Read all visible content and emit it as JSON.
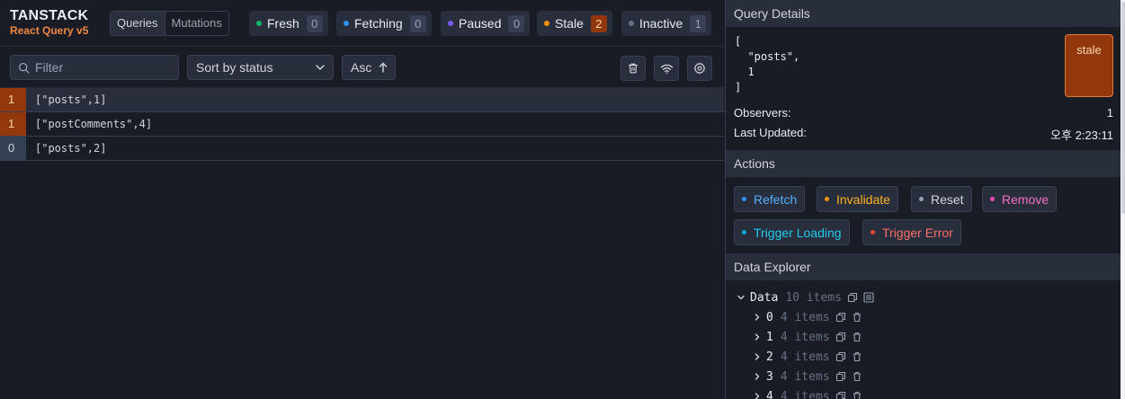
{
  "logo": {
    "main": "TANSTACK",
    "sub": "React Query v5"
  },
  "tabs": [
    {
      "label": "Queries",
      "active": true
    },
    {
      "label": "Mutations",
      "active": false
    }
  ],
  "statuses": [
    {
      "label": "Fresh",
      "count": "0",
      "color": "#12b76a"
    },
    {
      "label": "Fetching",
      "count": "0",
      "color": "#2e90fa"
    },
    {
      "label": "Paused",
      "count": "0",
      "color": "#7a5af8"
    },
    {
      "label": "Stale",
      "count": "2",
      "color": "#f79009"
    },
    {
      "label": "Inactive",
      "count": "1",
      "color": "#667085"
    }
  ],
  "toolbar": {
    "filter_placeholder": "Filter",
    "sort_label": "Sort by status",
    "order_label": "Asc",
    "icons": [
      "trash-icon",
      "wifi-icon",
      "gear-icon"
    ]
  },
  "queries": [
    {
      "count": "1",
      "key": "[\"posts\",1]",
      "state": "stale",
      "selected": true
    },
    {
      "count": "1",
      "key": "[\"postComments\",4]",
      "state": "stale",
      "selected": false
    },
    {
      "count": "0",
      "key": "[\"posts\",2]",
      "state": "inactive",
      "selected": false
    }
  ],
  "details": {
    "title": "Query Details",
    "json": "[\n  \"posts\",\n  1\n]",
    "status_badge": "stale",
    "observers_label": "Observers:",
    "observers_value": "1",
    "updated_label": "Last Updated:",
    "updated_value": "오후 2:23:11"
  },
  "actions": {
    "title": "Actions",
    "buttons": [
      {
        "label": "Refetch",
        "color": "#2e90fa",
        "text_color": "#53b1fd"
      },
      {
        "label": "Invalidate",
        "color": "#f79009",
        "text_color": "#fdb022"
      },
      {
        "label": "Reset",
        "color": "#98a2b3",
        "text_color": "#d0d5dd"
      },
      {
        "label": "Remove",
        "color": "#ee46bc",
        "text_color": "#f670c7"
      },
      {
        "label": "Trigger Loading",
        "color": "#06aed4",
        "text_color": "#22ccee"
      },
      {
        "label": "Trigger Error",
        "color": "#f04438",
        "text_color": "#f97066"
      }
    ]
  },
  "explorer": {
    "title": "Data Explorer",
    "root_label": "Data",
    "root_meta": "10 items",
    "children": [
      {
        "label": "0",
        "meta": "4 items"
      },
      {
        "label": "1",
        "meta": "4 items"
      },
      {
        "label": "2",
        "meta": "4 items"
      },
      {
        "label": "3",
        "meta": "4 items"
      },
      {
        "label": "4",
        "meta": "4 items"
      }
    ]
  }
}
